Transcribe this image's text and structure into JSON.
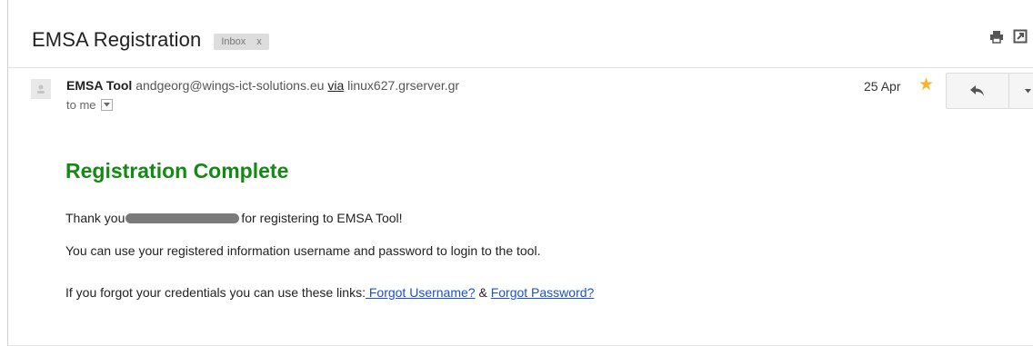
{
  "email": {
    "subject": "EMSA Registration",
    "label": {
      "text": "Inbox",
      "remove": "x"
    },
    "sender": {
      "name": "EMSA Tool",
      "email": "andgeorg@wings-ict-solutions.eu",
      "via_word": "via",
      "via_host": "linux627.grserver.gr"
    },
    "recipient": "to me",
    "date": "25 Apr",
    "starred": true,
    "body": {
      "heading": "Registration Complete",
      "thanks_prefix": "Thank you",
      "thanks_suffix": "for registering to EMSA Tool!",
      "info": "You can use your registered information username and password to login to the tool.",
      "forgot_prefix": "If you forgot your credentials you can use these links:",
      "forgot_username": " Forgot Username?",
      "amp": " & ",
      "forgot_password": "Forgot Password?"
    }
  },
  "colors": {
    "heading": "#138a13",
    "link": "#1a4fd6",
    "star": "#f7b42c",
    "label_bg": "#dddddd"
  },
  "icons": [
    "print-icon",
    "new-window-icon",
    "avatar-icon",
    "star-icon",
    "reply-icon",
    "chevron-down-icon"
  ]
}
